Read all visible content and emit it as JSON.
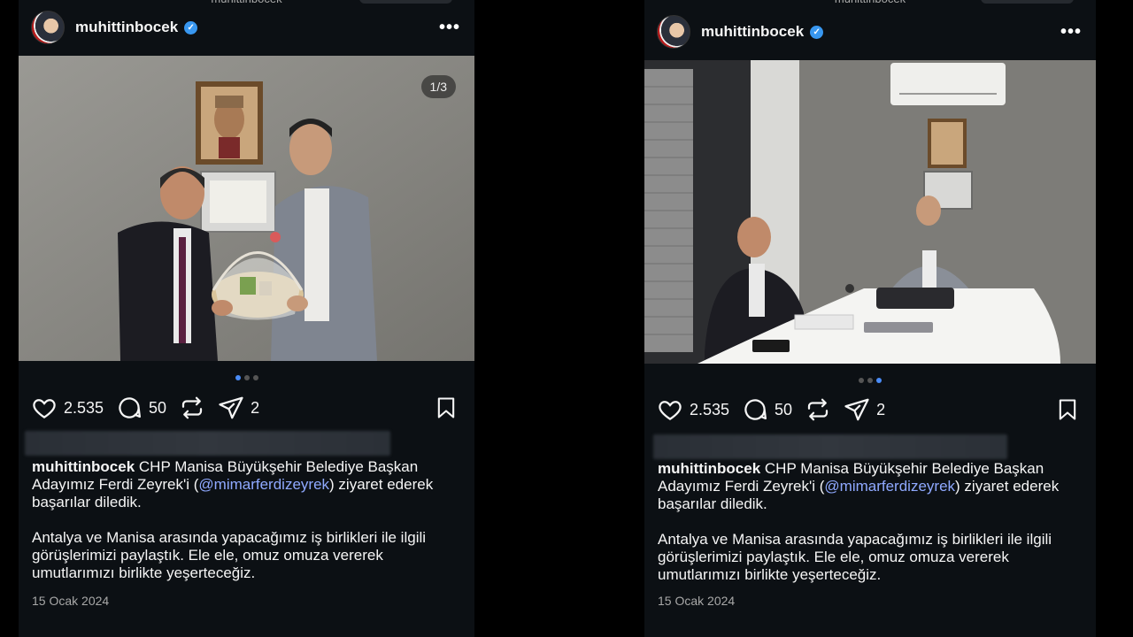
{
  "top_fragment": "muhittinbocek",
  "posts": [
    {
      "username": "muhittinbocek",
      "verified_glyph": "✓",
      "more_glyph": "•••",
      "counter": "1/3",
      "likes": "2.535",
      "comments": "50",
      "shares": "2",
      "caption_line1_text": "CHP Manisa Büyükşehir Belediye Başkan Adayımız Ferdi Zeyrek'i (",
      "mention": "@mimarferdizeyrek",
      "caption_line1_tail": ") ziyaret ederek başarılar diledik.",
      "caption_para2": "Antalya ve Manisa arasında yapacağımız iş birlikleri ile ilgili görüşlerimizi paylaştık. Ele ele, omuz omuza vererek umutlarımızı birlikte yeşerteceğiz.",
      "date": "15 Ocak 2024",
      "active_dot": 1
    },
    {
      "username": "muhittinbocek",
      "verified_glyph": "✓",
      "more_glyph": "•••",
      "likes": "2.535",
      "comments": "50",
      "shares": "2",
      "caption_line1_text": "CHP Manisa Büyükşehir Belediye Başkan Adayımız Ferdi Zeyrek'i (",
      "mention": "@mimarferdizeyrek",
      "caption_line1_tail": ") ziyaret ederek başarılar diledik.",
      "caption_para2": "Antalya ve Manisa arasında yapacağımız iş birlikleri ile ilgili görüşlerimizi paylaştık. Ele ele, omuz omuza vererek umutlarımızı birlikte yeşerteceğiz.",
      "date": "15 Ocak 2024",
      "active_dot": 3
    }
  ],
  "icons": {
    "like": "heart-icon",
    "comment": "comment-icon",
    "repost": "repost-icon",
    "share": "send-icon",
    "save": "bookmark-icon"
  },
  "colors": {
    "background": "#0c1014",
    "mention": "#8fa9ff",
    "verified": "#3897f0",
    "active_dot": "#4a8cf7"
  }
}
